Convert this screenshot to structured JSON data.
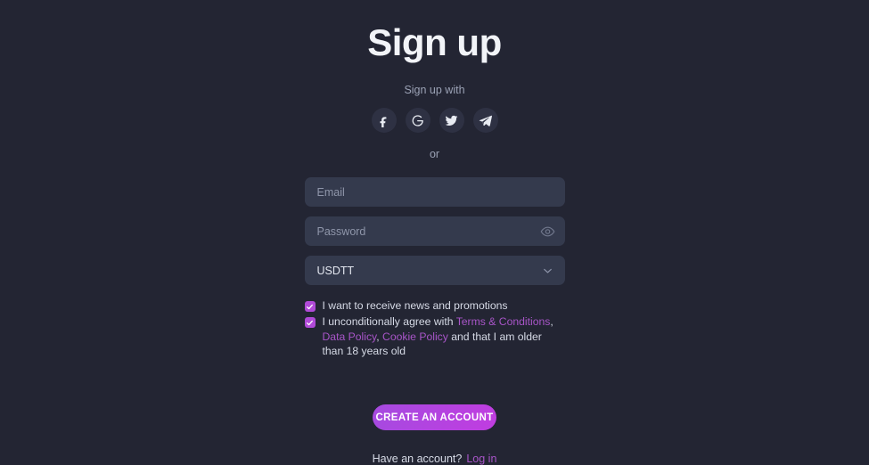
{
  "page": {
    "title": "Sign up",
    "signup_with_label": "Sign up with",
    "or_label": "or",
    "background_color": "#232533",
    "accent_color": "#b04ad8",
    "link_color": "#a855c8"
  },
  "social": {
    "providers": [
      {
        "name": "facebook",
        "icon": "facebook-icon"
      },
      {
        "name": "google",
        "icon": "google-icon"
      },
      {
        "name": "twitter",
        "icon": "twitter-icon"
      },
      {
        "name": "telegram",
        "icon": "telegram-icon"
      }
    ]
  },
  "form": {
    "email": {
      "placeholder": "Email",
      "value": ""
    },
    "password": {
      "placeholder": "Password",
      "value": "",
      "toggle_icon": "eye-icon"
    },
    "currency": {
      "selected": "USDTT",
      "chevron_icon": "chevron-down-icon"
    }
  },
  "consents": {
    "newsletter": {
      "checked": true,
      "label": "I want to receive news and promotions"
    },
    "terms": {
      "checked": true,
      "prefix": "I unconditionally agree with ",
      "terms_link": "Terms & Conditions",
      "sep1": ", ",
      "data_link": "Data Policy",
      "sep2": ", ",
      "cookie_link": "Cookie Policy",
      "suffix": " and that I am older than 18 years old"
    }
  },
  "actions": {
    "submit_label": "CREATE AN ACCOUNT"
  },
  "footer": {
    "question": "Have an account?",
    "login_label": "Log in"
  }
}
